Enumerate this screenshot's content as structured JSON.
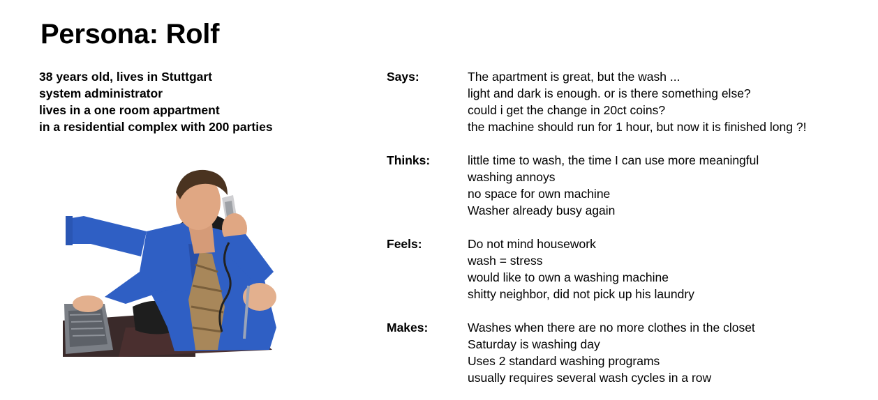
{
  "title": "Persona: Rolf",
  "facts": [
    "38 years old, lives in Stuttgart",
    "system administrator",
    "lives in a one room appartment",
    "in a residential complex with 200 parties"
  ],
  "photo_icon": "man-on-phone-at-computer",
  "sections": [
    {
      "label": "Says:",
      "lines": [
        "The apartment is great, but the wash ...",
        "light and dark is enough. or is there something else?",
        "could i get the change in 20ct coins?",
        "the machine should run for 1 hour, but now it is finished long ?!"
      ]
    },
    {
      "label": "Thinks:",
      "lines": [
        "little time to wash, the time I can use more meaningful",
        "washing annoys",
        "no space for own machine",
        "Washer already busy again"
      ]
    },
    {
      "label": "Feels:",
      "lines": [
        "Do not mind housework",
        "wash = stress",
        "would like to own a washing machine",
        "shitty neighbor, did not pick up his laundry"
      ]
    },
    {
      "label": "Makes:",
      "lines": [
        "Washes when there are no more clothes in the closet",
        "Saturday is washing day",
        "Uses 2 standard washing programs",
        "usually requires several wash cycles in a row"
      ]
    }
  ]
}
